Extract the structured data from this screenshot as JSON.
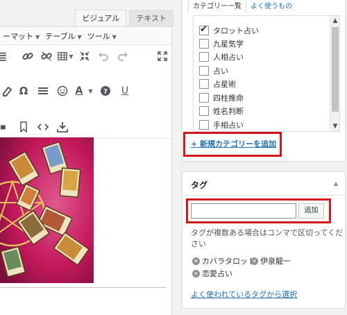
{
  "editor": {
    "tabs": [
      {
        "label": "ビジュアル",
        "active": true
      },
      {
        "label": "テキスト",
        "active": false
      }
    ],
    "menubar": [
      {
        "label": "ーマット"
      },
      {
        "label": "テーブル"
      },
      {
        "label": "ツール"
      }
    ],
    "toolbar_row1_icons": [
      "list-icon",
      "link-icon",
      "unlink-icon",
      "table-icon",
      "undo-icon",
      "redo-icon",
      "fullscreen-icon"
    ],
    "toolbar_row2": {
      "omega": "Ω",
      "underline": "U",
      "text_color": "A"
    },
    "toolbar_row3_icons": [
      "print-icon",
      "bookmark-icon",
      "code-icon",
      "download-icon"
    ]
  },
  "categories": {
    "tabs": [
      {
        "label": "カテゴリー一覧",
        "active": true
      },
      {
        "label": "よく使うもの",
        "active": false
      }
    ],
    "items": [
      {
        "label": "タロット占い",
        "checked": true
      },
      {
        "label": "九星気学",
        "checked": false
      },
      {
        "label": "人相占い",
        "checked": false
      },
      {
        "label": "占い",
        "checked": false
      },
      {
        "label": "占星術",
        "checked": false
      },
      {
        "label": "四柱推命",
        "checked": false
      },
      {
        "label": "姓名判断",
        "checked": false
      },
      {
        "label": "手相占い",
        "checked": false
      }
    ],
    "add_new_link": "+ 新規カテゴリーを追加"
  },
  "tags": {
    "title": "タグ",
    "input_value": "",
    "add_button": "追加",
    "hint": "タグが複数ある場合はコンマで区切ってください",
    "chips": [
      "カバラタロット",
      "伊泉龍一",
      "恋愛占い"
    ],
    "popular_link": "よく使われているタグから選択"
  },
  "colors": {
    "highlight": "#d4161d",
    "link": "#2271b1",
    "image_bg": "#c2185b"
  }
}
